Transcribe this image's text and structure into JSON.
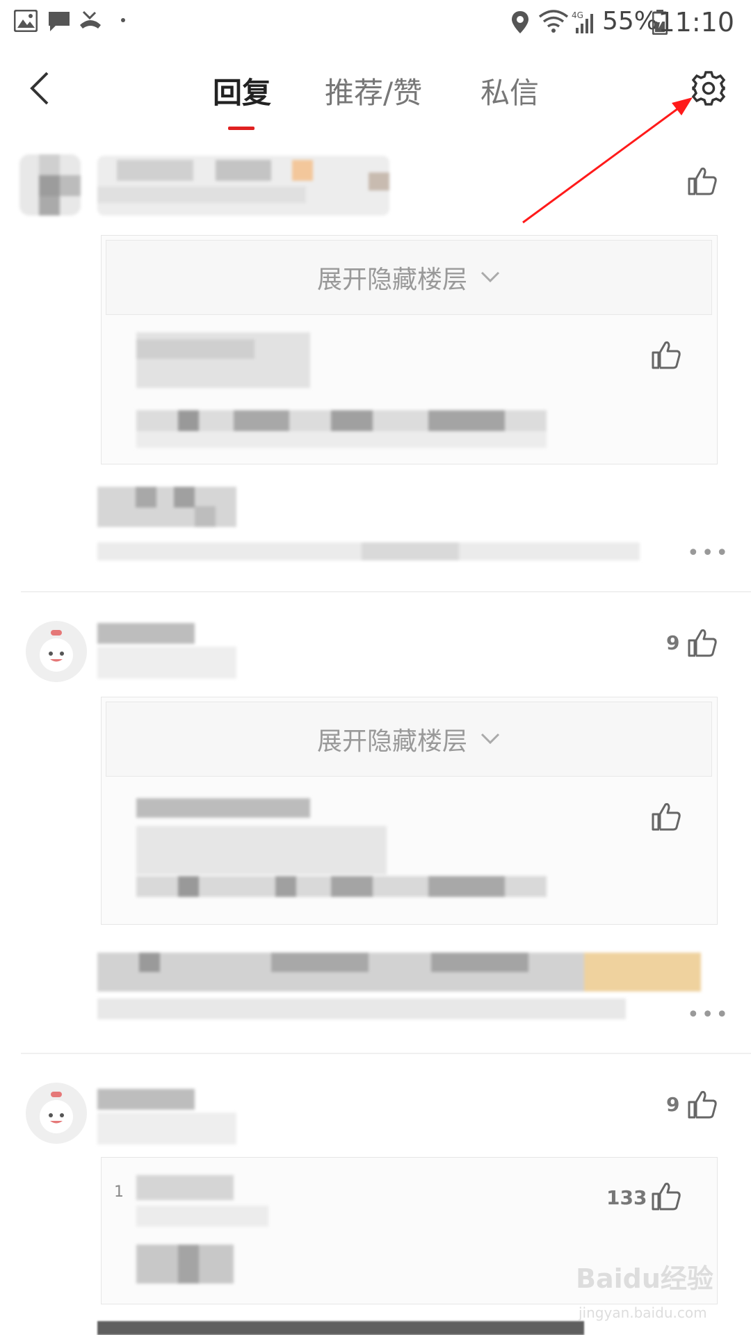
{
  "status_bar": {
    "battery": "55%",
    "time": "11:10"
  },
  "header": {
    "tabs": [
      {
        "label": "回复",
        "active": true
      },
      {
        "label": "推荐/赞",
        "active": false
      },
      {
        "label": "私信",
        "active": false
      }
    ]
  },
  "threads": [
    {
      "expand_label": "展开隐藏楼层",
      "like_count": ""
    },
    {
      "expand_label": "展开隐藏楼层",
      "like_count": "9"
    },
    {
      "like_count": "9",
      "quote_index": "1",
      "quote_like_count": "133"
    }
  ],
  "watermark": {
    "brand": "Baidu经验",
    "url": "jingyan.baidu.com"
  },
  "colors": {
    "accent": "#e02020",
    "annotation_arrow": "#ff1a1a"
  },
  "icons": [
    "back-arrow-icon",
    "gear-icon",
    "thumbs-up-icon",
    "more-dots-icon",
    "chevron-down-icon"
  ]
}
